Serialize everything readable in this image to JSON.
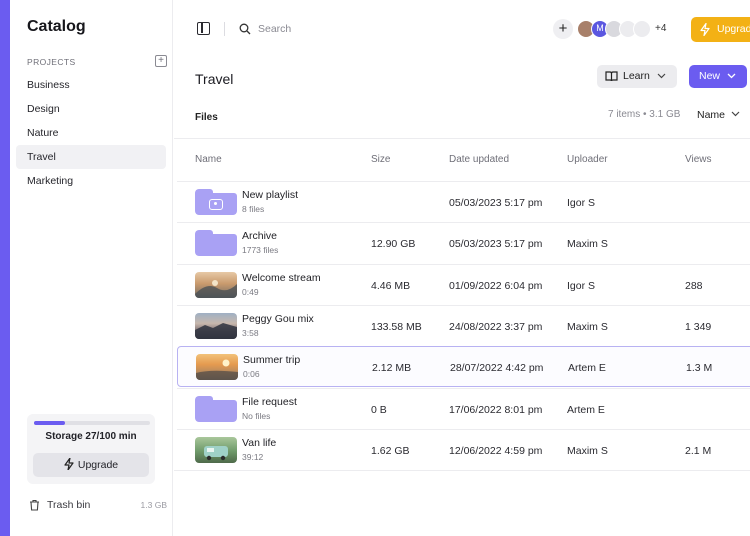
{
  "app": {
    "title": "Catalog"
  },
  "sidebar": {
    "projects_label": "PROJECTS",
    "items": [
      {
        "label": "Business",
        "active": false
      },
      {
        "label": "Design",
        "active": false
      },
      {
        "label": "Nature",
        "active": false
      },
      {
        "label": "Travel",
        "active": true
      },
      {
        "label": "Marketing",
        "active": false
      }
    ],
    "storage": {
      "text": "Storage 27/100 min",
      "used_fraction": 0.27,
      "upgrade_label": "Upgrade"
    },
    "trash": {
      "label": "Trash bin",
      "size": "1.3 GB"
    }
  },
  "topbar": {
    "search_placeholder": "Search",
    "avatar_initial": "M",
    "more_count": "+4",
    "upgrade_label": "Upgrade"
  },
  "page": {
    "title": "Travel",
    "learn_label": "Learn",
    "new_label": "New",
    "files_heading": "Files",
    "files_meta": "7 items • 3.1 GB",
    "sort_label": "Name"
  },
  "table": {
    "columns": [
      "Name",
      "Size",
      "Date updated",
      "Uploader",
      "Views"
    ],
    "rows": [
      {
        "name": "New playlist",
        "sub": "8 files",
        "size": "",
        "date": "05/03/2023 5:17 pm",
        "uploader": "Igor S",
        "views": "",
        "kind": "playlist-folder"
      },
      {
        "name": "Archive",
        "sub": "1773 files",
        "size": "12.90 GB",
        "date": "05/03/2023 5:17 pm",
        "uploader": "Maxim S",
        "views": "",
        "kind": "folder"
      },
      {
        "name": "Welcome stream",
        "sub": "0:49",
        "size": "4.46 MB",
        "date": "01/09/2022 6:04 pm",
        "uploader": "Igor S",
        "views": "288",
        "kind": "video"
      },
      {
        "name": "Peggy Gou mix",
        "sub": "3:58",
        "size": "133.58 MB",
        "date": "24/08/2022 3:37 pm",
        "uploader": "Maxim S",
        "views": "1 349",
        "kind": "video"
      },
      {
        "name": "Summer trip",
        "sub": "0:06",
        "size": "2.12 MB",
        "date": "28/07/2022 4:42 pm",
        "uploader": "Artem E",
        "views": "1.3 M",
        "kind": "video"
      },
      {
        "name": "File request",
        "sub": "No files",
        "size": "0 B",
        "date": "17/06/2022 8:01 pm",
        "uploader": "Artem E",
        "views": "",
        "kind": "folder"
      },
      {
        "name": "Van life",
        "sub": "39:12",
        "size": "1.62 GB",
        "date": "12/06/2022 4:59 pm",
        "uploader": "Maxim S",
        "views": "2.1 M",
        "kind": "video"
      }
    ]
  },
  "colors": {
    "accent": "#6b5cf0",
    "upgrade": "#f3b115",
    "folder": "#a9a1f4",
    "selected_border": "#b8b2f2"
  }
}
